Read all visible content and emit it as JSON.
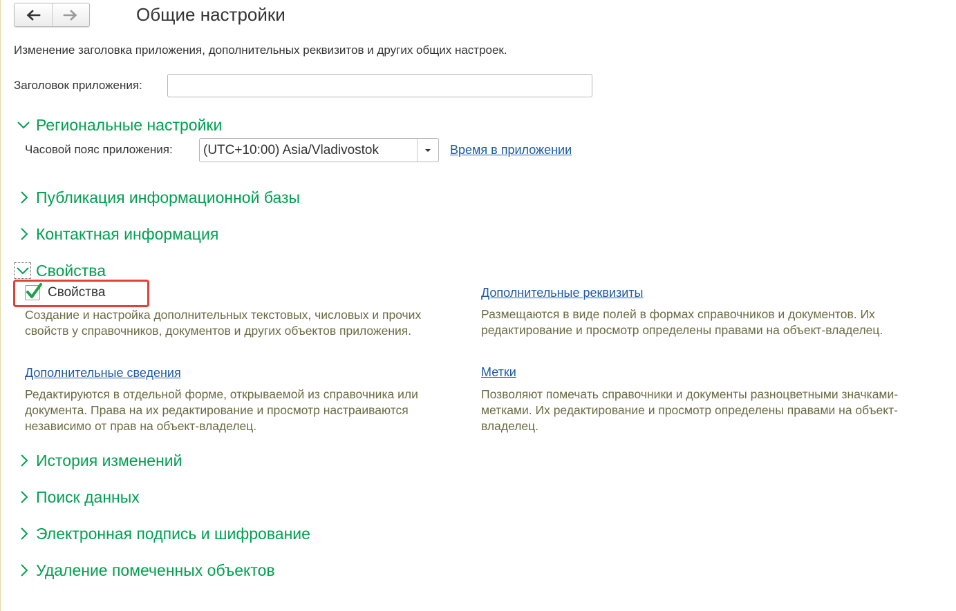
{
  "nav": {
    "back_icon": "arrow-left-icon",
    "forward_icon": "arrow-right-icon"
  },
  "title": "Общие настройки",
  "description": "Изменение заголовка приложения, дополнительных реквизитов и других общих настроек.",
  "app_title": {
    "label": "Заголовок приложения:",
    "value": ""
  },
  "groups": {
    "regional": {
      "title": "Региональные настройки",
      "expanded": true,
      "timezone_label": "Часовой пояс приложения:",
      "timezone_value": "(UTC+10:00) Asia/Vladivostok",
      "time_link": "Время в приложении"
    },
    "publication": {
      "title": "Публикация информационной базы",
      "expanded": false
    },
    "contact": {
      "title": "Контактная информация",
      "expanded": false
    },
    "properties": {
      "title": "Свойства",
      "expanded": true,
      "checkbox_label": "Свойства",
      "checkbox_checked": true,
      "checkbox_desc": "Создание и настройка дополнительных текстовых, числовых и прочих свойств у справочников, документов и других объектов приложения.",
      "extra_attrs_link": "Дополнительные реквизиты",
      "extra_attrs_desc": "Размещаются в виде полей в формах справочников и документов. Их редактирование и просмотр определены правами на объект-владелец.",
      "extra_info_link": "Дополнительные сведения",
      "extra_info_desc": "Редактируются в отдельной форме, открываемой из справочника или документа. Права на их редактирование и просмотр настраиваются независимо от прав на объект-владелец.",
      "tags_link": "Метки",
      "tags_desc": "Позволяют помечать справочники и документы разноцветными значками-метками. Их редактирование и просмотр определены правами на объект-владелец."
    },
    "history": {
      "title": "История изменений",
      "expanded": false
    },
    "search": {
      "title": "Поиск данных",
      "expanded": false
    },
    "signature": {
      "title": "Электронная подпись и шифрование",
      "expanded": false
    },
    "deletion": {
      "title": "Удаление помеченных объектов",
      "expanded": false
    }
  },
  "colors": {
    "group_title": "#00a050",
    "link": "#1c5aa6",
    "hint": "#6b6b45",
    "highlight": "#e0413a"
  }
}
